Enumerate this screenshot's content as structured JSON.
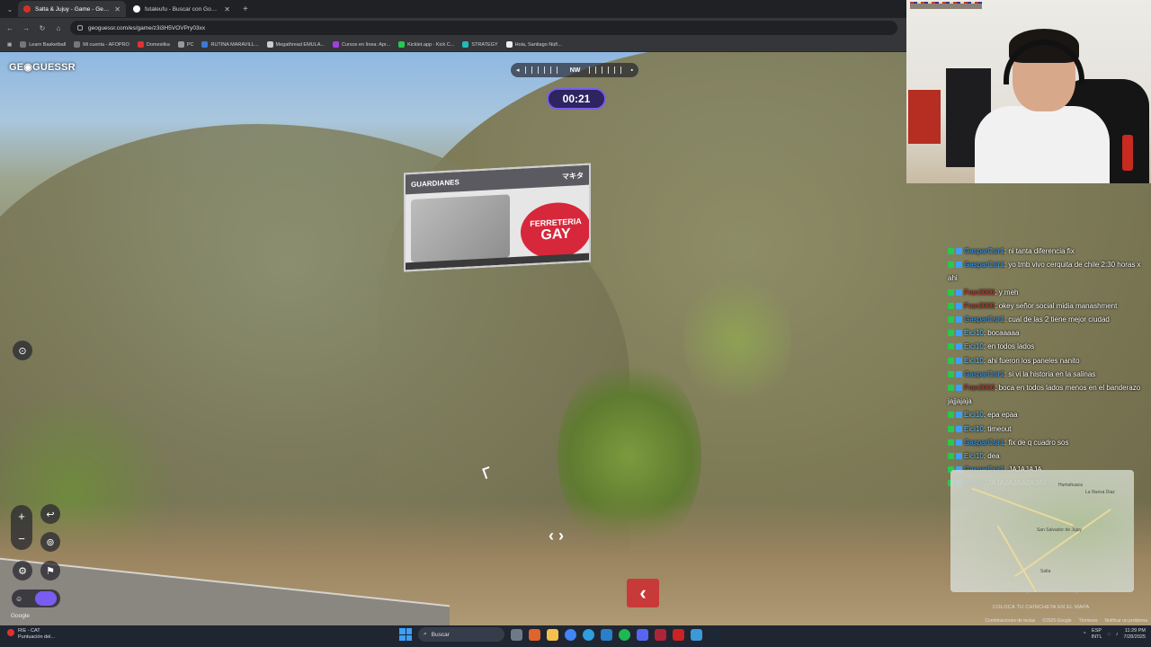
{
  "browser": {
    "tabs": [
      {
        "title": "Salta & Jujuy - Game - GeoGue",
        "active": true,
        "favicon_color": "#d93025"
      },
      {
        "title": "futaleufu - Buscar con Google",
        "active": false,
        "favicon_color": "#ffffff"
      }
    ],
    "url": "geoguessr.com/es/game/z3i3H5VOVPry03xx",
    "bookmarks": [
      "Learn Basketball",
      "Mi cuenta - AFOPRO",
      "Domestika",
      "PC",
      "RUTINA MARAVILL...",
      "Megathread EMULA...",
      "Cursos en línea: Apr...",
      "Kicklet.app - Kick C...",
      "STRATEGY",
      "Hola, Santiago Núñ..."
    ]
  },
  "game": {
    "logo": "GE◉GUESSR",
    "compass_direction": "NW",
    "timer": "00:21",
    "google_mark": "Google",
    "billboard": {
      "header_left": "GUARDIANES",
      "header_right": "マキタ",
      "circle_line1": "FERRETERIA",
      "circle_line2": "GAY"
    }
  },
  "chat": [
    {
      "user": "GasparCsir1",
      "text": ": ni tanta diferencia fix",
      "color": "#3aa0ff"
    },
    {
      "user": "GasparCsir1",
      "text": ": yo tmb vivo cerquita de chile 2:30 horas x ahi",
      "color": "#3aa0ff"
    },
    {
      "user": "Fran3000",
      "text": ": y meh",
      "color": "#e03030"
    },
    {
      "user": "Fran3000",
      "text": ": okey señor social midia manashment",
      "color": "#e03030"
    },
    {
      "user": "GasparCsir1",
      "text": ": cual de las 2 tiene mejor ciudad",
      "color": "#3aa0ff"
    },
    {
      "user": "Eici10",
      "text": ": bocaaaaa",
      "color": "#6fc8ff"
    },
    {
      "user": "Eici10",
      "text": ": en todos lados",
      "color": "#6fc8ff"
    },
    {
      "user": "Eici10",
      "text": ": ahi fueron los paneles nanito",
      "color": "#6fc8ff"
    },
    {
      "user": "GasparCsir1",
      "text": ": si vi la historia en la salinas",
      "color": "#3aa0ff"
    },
    {
      "user": "Fran3000",
      "text": ": boca en todos lados menos en el banderazo jajjajaja",
      "color": "#e03030"
    },
    {
      "user": "Eici10",
      "text": ": epa epaa",
      "color": "#6fc8ff"
    },
    {
      "user": "Eici10",
      "text": ": timeout",
      "color": "#6fc8ff"
    },
    {
      "user": "GasparCsir1",
      "text": ": fix de q cuadro sos",
      "color": "#3aa0ff"
    },
    {
      "user": "Eici10",
      "text": ": dea",
      "color": "#6fc8ff"
    },
    {
      "user": "GasparCsir1",
      "text": ": JAJAJAJA",
      "color": "#3aa0ff"
    },
    {
      "user": "Eici10",
      "text": ": JAJAJAJAAJAJAJ",
      "color": "#6fc8ff"
    }
  ],
  "minimap": {
    "towns": [
      "Humahuaca",
      "La Nueva Diaz",
      "Salta",
      "San Salvador de Jujuy"
    ],
    "footer": "Datos del mapa   Términos   Notificar un problema",
    "cta": "COLOCA TU CHINCHETA EN EL MAPA"
  },
  "legal": [
    "Combinaciones de teclas",
    "©2025 Google",
    "Términos",
    "Notificar un problema"
  ],
  "taskbar": {
    "weather_title": "RIE - CAT",
    "weather_sub": "Puntuación del...",
    "search_placeholder": "Buscar",
    "lang_top": "ESP",
    "lang_bottom": "INTL",
    "time": "11:29 PM",
    "date": "7/28/2025"
  }
}
